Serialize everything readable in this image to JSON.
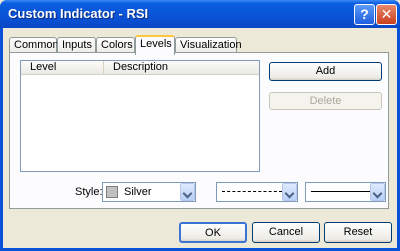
{
  "window": {
    "title": "Custom Indicator - RSI",
    "help_label": "?",
    "close_label": "✕"
  },
  "tabs": [
    {
      "label": "Common"
    },
    {
      "label": "Inputs"
    },
    {
      "label": "Colors"
    },
    {
      "label": "Levels",
      "active": true
    },
    {
      "label": "Visualization"
    }
  ],
  "levels": {
    "columns": [
      "Level",
      "Description"
    ],
    "rows": [],
    "add_label": "Add",
    "delete_label": "Delete"
  },
  "style": {
    "label": "Style:",
    "color_value": "Silver",
    "color_hex": "#c0c0c0",
    "line_style": "dashed",
    "line_width": "solid"
  },
  "footer": {
    "ok_label": "OK",
    "cancel_label": "Cancel",
    "reset_label": "Reset"
  }
}
